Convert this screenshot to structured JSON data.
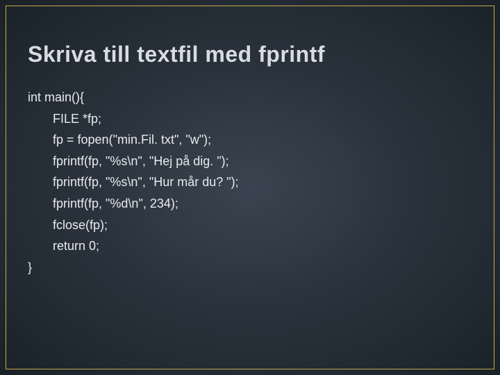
{
  "slide": {
    "title": "Skriva till textfil med fprintf",
    "code": {
      "l0": "int main(){",
      "l1": "FILE *fp;",
      "l2": "fp = fopen(\"min.Fil. txt\", \"w\");",
      "l3": "fprintf(fp, \"%s\\n\", \"Hej på dig. \");",
      "l4": "fprintf(fp, \"%s\\n\", \"Hur mår du? \");",
      "l5": "fprintf(fp, \"%d\\n\", 234);",
      "l6": "fclose(fp);",
      "l7": "return 0;",
      "l8": "}"
    }
  }
}
